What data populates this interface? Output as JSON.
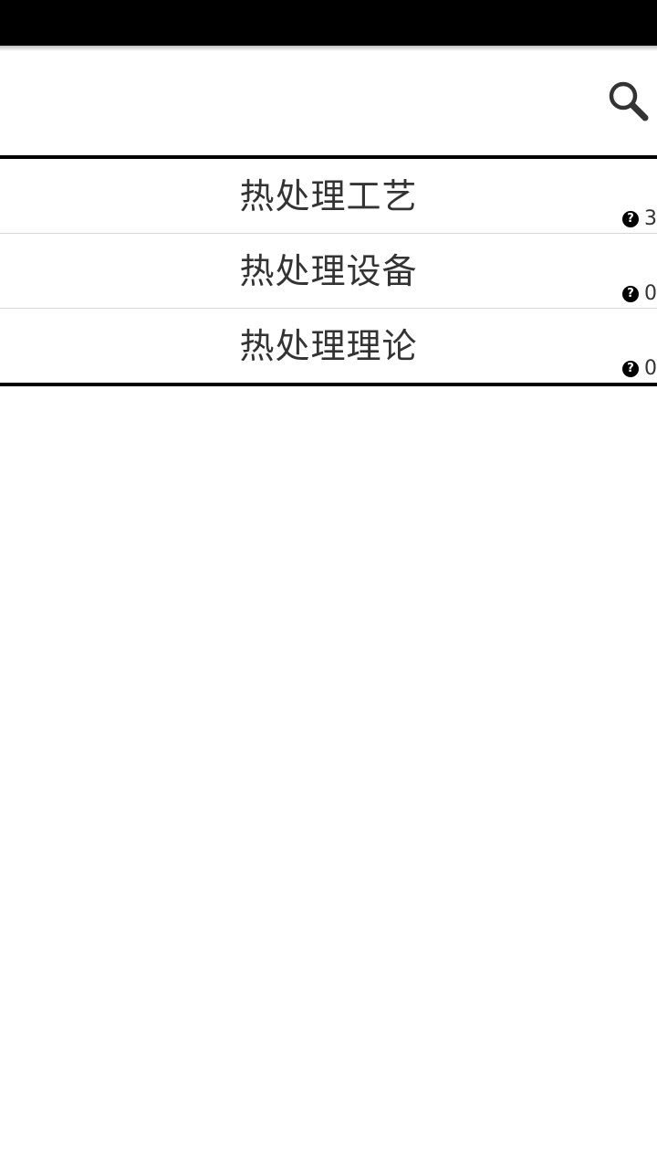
{
  "toolbar": {
    "search_icon": "search-icon"
  },
  "list": {
    "items": [
      {
        "label": "热处理工艺",
        "count": "3"
      },
      {
        "label": "热处理设备",
        "count": "0"
      },
      {
        "label": "热处理理论",
        "count": "0"
      }
    ]
  },
  "colors": {
    "status_bar": "#000000",
    "divider": "#000000",
    "text": "#333333"
  }
}
